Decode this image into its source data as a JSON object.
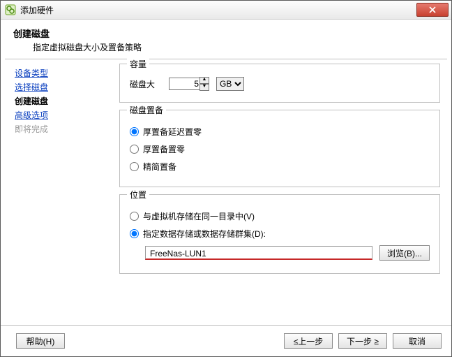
{
  "window": {
    "title": "添加硬件"
  },
  "header": {
    "title": "创建磁盘",
    "subtitle": "指定虚拟磁盘大小及置备策略"
  },
  "sidebar": {
    "items": [
      {
        "label": "设备类型",
        "kind": "link"
      },
      {
        "label": "选择磁盘",
        "kind": "link"
      },
      {
        "label": "创建磁盘",
        "kind": "current"
      },
      {
        "label": "高级选项",
        "kind": "link"
      },
      {
        "label": "即将完成",
        "kind": "disabled"
      }
    ]
  },
  "capacity": {
    "legend": "容量",
    "size_label": "磁盘大",
    "size_value": "5",
    "unit_options": [
      "GB"
    ],
    "unit_selected": "GB"
  },
  "provision": {
    "legend": "磁盘置备",
    "options": [
      {
        "label": "厚置备延迟置零",
        "checked": true
      },
      {
        "label": "厚置备置零",
        "checked": false
      },
      {
        "label": "精简置备",
        "checked": false
      }
    ]
  },
  "location": {
    "legend": "位置",
    "options": [
      {
        "label": "与虚拟机存储在同一目录中(V)",
        "checked": false
      },
      {
        "label": "指定数据存储或数据存储群集(D):",
        "checked": true
      }
    ],
    "datastore": "FreeNas-LUN1",
    "browse_label": "浏览(B)..."
  },
  "footer": {
    "help": "帮助(H)",
    "back": "≤上一步",
    "next": "下一步 ≥",
    "cancel": "取消"
  }
}
